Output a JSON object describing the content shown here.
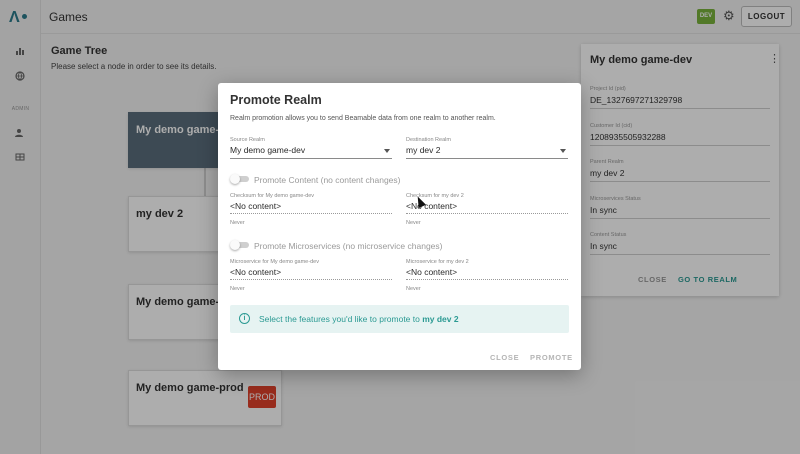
{
  "app": {
    "title": "Games",
    "env_badge": "DEV",
    "logout_label": "LOGOUT",
    "sidebar_section_label": "ADMIN"
  },
  "colors": {
    "accent": "#2b9a93",
    "logo": "#2b7b8b",
    "selected_node": "#5b6e7c",
    "dev_badge": "#79b33b",
    "prod_badge": "#e0412c"
  },
  "icons": {
    "sidebar": [
      "chart-icon",
      "globe-icon",
      "users-icon",
      "table-icon"
    ],
    "topbar": [
      "gear-icon"
    ]
  },
  "tree": {
    "title": "Game Tree",
    "subtitle": "Please select a node in order to see its details.",
    "nodes": [
      {
        "label": "My demo game-dev"
      },
      {
        "label": "my dev 2"
      },
      {
        "label": "My demo game-stage"
      },
      {
        "label": "My demo game-prod"
      }
    ],
    "prod_badge": "PROD"
  },
  "detail": {
    "title": "My demo game-dev",
    "fields": [
      {
        "label": "Project Id (pid)",
        "value": "DE_1327697271329798"
      },
      {
        "label": "Customer Id (cid)",
        "value": "1208935505932288"
      },
      {
        "label": "Parent Realm",
        "value": "my dev 2"
      },
      {
        "label": "Microservices Status",
        "value": "In sync"
      },
      {
        "label": "Content Status",
        "value": "In sync"
      }
    ],
    "close_label": "CLOSE",
    "go_label": "GO TO REALM"
  },
  "modal": {
    "title": "Promote Realm",
    "description": "Realm promotion allows you to send Beamable data from one realm to another realm.",
    "source": {
      "label": "Source Realm",
      "value": "My demo game-dev"
    },
    "destination": {
      "label": "Destination Realm",
      "value": "my dev 2"
    },
    "content": {
      "toggle_label": "Promote Content (no content changes)",
      "source_label": "Checksum for My demo game-dev",
      "source_value": "<No content>",
      "source_foot": "Never",
      "dest_label": "Checksum for my dev 2",
      "dest_value": "<No content>",
      "dest_foot": "Never"
    },
    "microservices": {
      "toggle_label": "Promote Microservices (no microservice changes)",
      "source_label": "Microservice for My demo game-dev",
      "source_value": "<No content>",
      "source_foot": "Never",
      "dest_label": "Microservice for my dev 2",
      "dest_value": "<No content>",
      "dest_foot": "Never"
    },
    "info": {
      "text": "Select the features you'd like to promote to ",
      "target": "my dev 2"
    },
    "close_label": "CLOSE",
    "promote_label": "PROMOTE"
  }
}
